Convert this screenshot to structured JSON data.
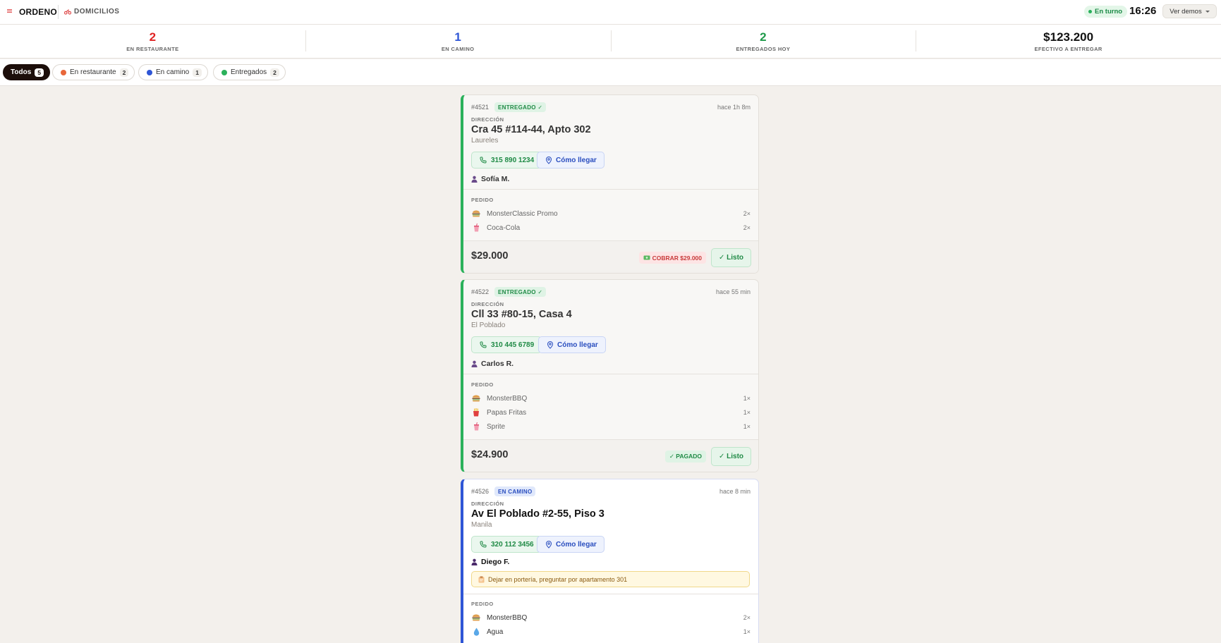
{
  "header": {
    "brand": "ORDENO",
    "section": "DOMICILIOS",
    "shift_status": "En turno",
    "clock": "16:26",
    "demos_label": "Ver demos"
  },
  "stats": [
    {
      "value": "2",
      "label": "EN RESTAURANTE",
      "color": "#e02424"
    },
    {
      "value": "1",
      "label": "EN CAMINO",
      "color": "#2f56d6"
    },
    {
      "value": "2",
      "label": "ENTREGADOS HOY",
      "color": "#1f9a4a"
    },
    {
      "value": "$123.200",
      "label": "EFECTIVO A ENTREGAR",
      "color": "#111111"
    }
  ],
  "filters": [
    {
      "label": "Todos",
      "count": "5",
      "active": true
    },
    {
      "label": "En restaurante",
      "count": "2",
      "dot_color": "#e8673a"
    },
    {
      "label": "En camino",
      "count": "1",
      "dot_color": "#2f56d6"
    },
    {
      "label": "Entregados",
      "count": "2",
      "dot_color": "#2bb15b"
    }
  ],
  "orders": [
    {
      "id": "#4521",
      "status": "ENTREGADO ✓",
      "time_ago": "hace 1h 8m",
      "address_label": "DIRECCIÓN",
      "address": "Cra 45 #114-44, Apto 302",
      "neighborhood": "Laureles",
      "phone": "315 890 1234",
      "map_label": "Cómo llegar",
      "customer": "Sofía M.",
      "items_label": "PEDIDO",
      "items": [
        {
          "icon": "burger-icon",
          "name": "MonsterClassic Promo",
          "qty": "2×"
        },
        {
          "icon": "drink-icon",
          "name": "Coca-Cola",
          "qty": "2×"
        }
      ],
      "total": "$29.000",
      "payment": "COBRAR $29.000",
      "action": "✓ Listo"
    },
    {
      "id": "#4522",
      "status": "ENTREGADO ✓",
      "time_ago": "hace 55 min",
      "address_label": "DIRECCIÓN",
      "address": "Cll 33 #80-15, Casa 4",
      "neighborhood": "El Poblado",
      "phone": "310 445 6789",
      "map_label": "Cómo llegar",
      "customer": "Carlos R.",
      "items_label": "PEDIDO",
      "items": [
        {
          "icon": "burger-icon",
          "name": "MonsterBBQ",
          "qty": "1×"
        },
        {
          "icon": "fries-icon",
          "name": "Papas Fritas",
          "qty": "1×"
        },
        {
          "icon": "drink-icon",
          "name": "Sprite",
          "qty": "1×"
        }
      ],
      "total": "$24.900",
      "payment": "✓ PAGADO",
      "action": "✓ Listo"
    },
    {
      "id": "#4526",
      "status": "EN CAMINO",
      "time_ago": "hace 8 min",
      "address_label": "DIRECCIÓN",
      "address": "Av El Poblado #2-55, Piso 3",
      "neighborhood": "Manila",
      "phone": "320 112 3456",
      "map_label": "Cómo llegar",
      "customer": "Diego F.",
      "note": "Dejar en portería, preguntar por apartamento 301",
      "items_label": "PEDIDO",
      "items": [
        {
          "icon": "burger-icon",
          "name": "MonsterBBQ",
          "qty": "2×"
        },
        {
          "icon": "water-drop-icon",
          "name": "Agua",
          "qty": "1×"
        }
      ]
    }
  ]
}
